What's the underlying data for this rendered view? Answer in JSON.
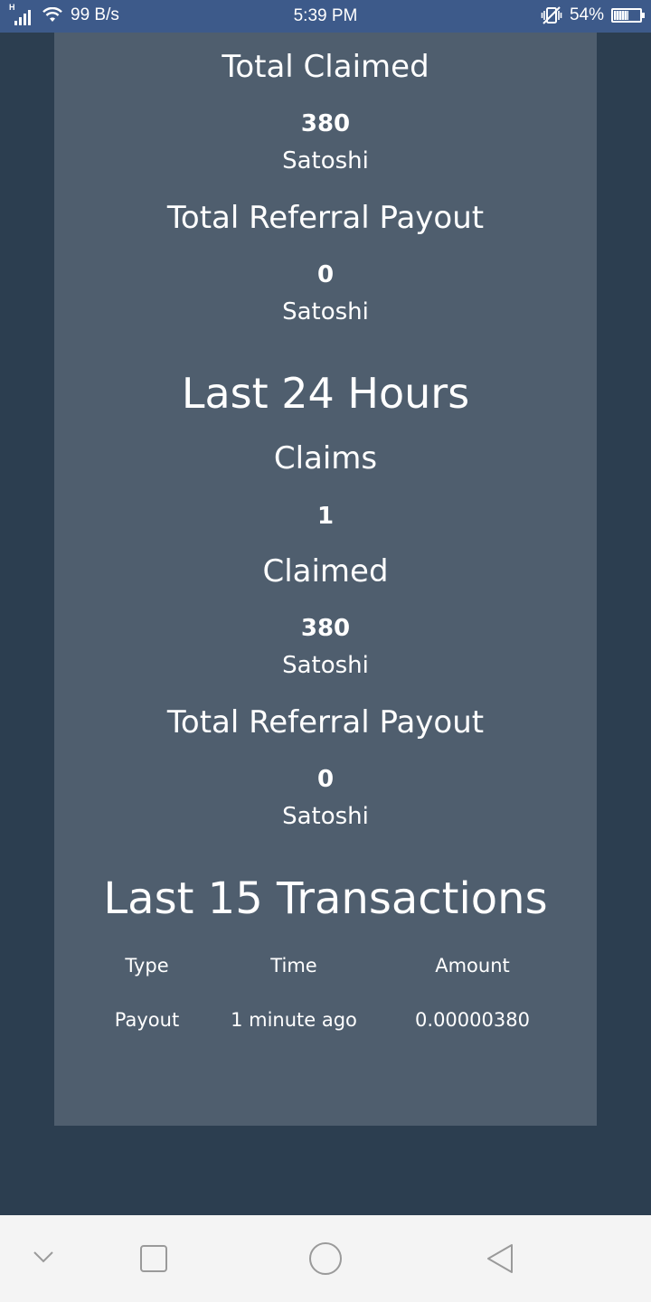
{
  "status_bar": {
    "net_speed": "99 B/s",
    "time": "5:39 PM",
    "battery": "54%",
    "network_type": "H",
    "icons": [
      "signal-icon",
      "wifi-icon",
      "vibrate-icon",
      "battery-icon"
    ]
  },
  "lifetime": {
    "total_claimed": {
      "label": "Total Claimed",
      "value": "380",
      "unit": "Satoshi"
    },
    "total_referral": {
      "label": "Total Referral Payout",
      "value": "0",
      "unit": "Satoshi"
    }
  },
  "last24": {
    "heading": "Last 24 Hours",
    "claims": {
      "label": "Claims",
      "value": "1"
    },
    "claimed": {
      "label": "Claimed",
      "value": "380",
      "unit": "Satoshi"
    },
    "referral": {
      "label": "Total Referral Payout",
      "value": "0",
      "unit": "Satoshi"
    }
  },
  "transactions": {
    "heading": "Last 15 Transactions",
    "columns": [
      "Type",
      "Time",
      "Amount"
    ],
    "rows": [
      {
        "type": "Payout",
        "time": "1 minute ago",
        "amount": "0.00000380"
      }
    ]
  },
  "nav_bar": {
    "icons": [
      "collapse-icon",
      "recents-icon",
      "home-icon",
      "back-icon"
    ]
  },
  "colors": {
    "background": "#2c3e50",
    "card": "#4f5e6e",
    "status_bar": "#3d5a8a",
    "nav_bar": "#f4f4f4"
  }
}
